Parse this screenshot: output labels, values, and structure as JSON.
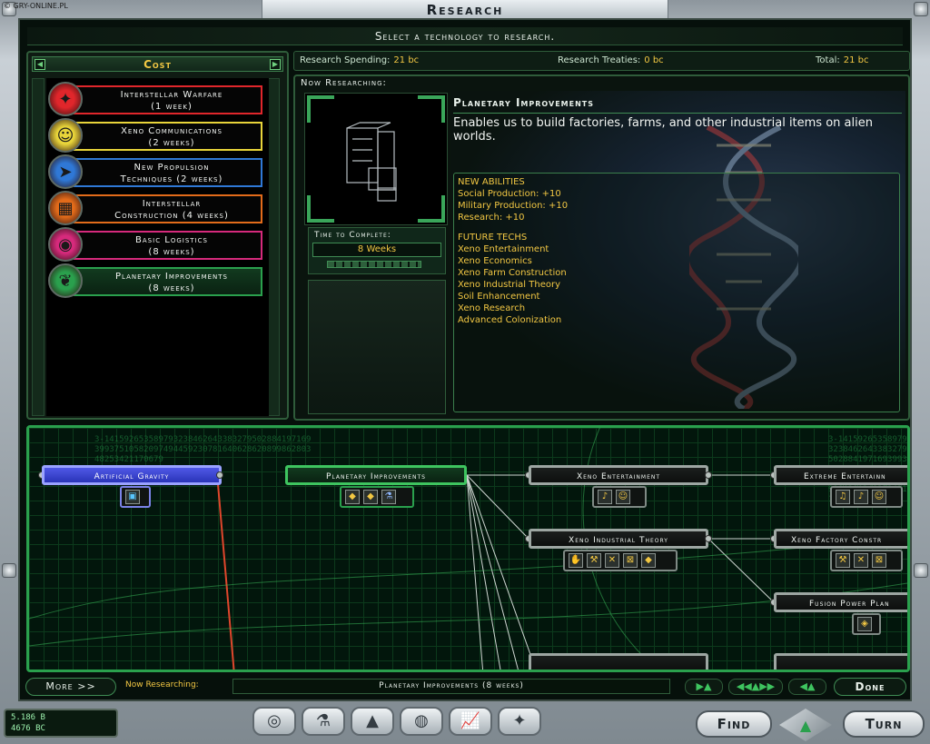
{
  "watermark": "© GRY-ONLINE.PL",
  "window": {
    "title": "Research",
    "subtitle": "Select a technology to research."
  },
  "cost_panel": {
    "title": "Cost",
    "prev_icon": "arrow-left-icon",
    "next_icon": "arrow-right-icon",
    "items": [
      {
        "line1": "Interstellar Warfare",
        "line2": "(1 week)",
        "icon": "warfare-icon",
        "color": "#e0262b"
      },
      {
        "line1": "Xeno Communications",
        "line2": "(2 weeks)",
        "icon": "communications-icon",
        "color": "#e8d43a"
      },
      {
        "line1": "New Propulsion",
        "line2": "Techniques (2 weeks)",
        "icon": "propulsion-icon",
        "color": "#2f78d6"
      },
      {
        "line1": "Interstellar",
        "line2": "Construction (4 weeks)",
        "icon": "construction-icon",
        "color": "#e26b1a"
      },
      {
        "line1": "Basic Logistics",
        "line2": "(8 weeks)",
        "icon": "logistics-icon",
        "color": "#d62a7c"
      },
      {
        "line1": "Planetary Improvements",
        "line2": "(8 weeks)",
        "icon": "planetary-icon",
        "color": "#2aa04d"
      }
    ]
  },
  "info_bar": {
    "spending_label": "Research Spending:",
    "spending_value": "21 bc",
    "treaties_label": "Research Treaties:",
    "treaties_value": "0 bc",
    "total_label": "Total:",
    "total_value": "21 bc"
  },
  "now_researching": {
    "label": "Now Researching:",
    "tech_name": "Planetary Improvements",
    "description": "Enables us to build factories, farms, and other industrial items on alien worlds.",
    "time_label": "Time to Complete:",
    "time_value": "8 Weeks",
    "progress": 1.0,
    "new_abilities_head": "NEW ABILITIES",
    "new_abilities": [
      "Social Production: +10",
      "Military Production: +10",
      "Research: +10"
    ],
    "future_techs_head": "FUTURE TECHS",
    "future_techs": [
      "Xeno Entertainment",
      "Xeno Economics",
      "Xeno Farm Construction",
      "Xeno Industrial Theory",
      "Soil Enhancement",
      "Xeno Research",
      "Advanced Colonization"
    ]
  },
  "tree": {
    "nodes": {
      "artificial_gravity": "Artificial Gravity",
      "planetary_improvements": "Planetary Improvements",
      "xeno_entertainment": "Xeno Entertainment",
      "extreme_entertainment": "Extreme Entertainn",
      "xeno_industrial_theory": "Xeno Industrial Theory",
      "xeno_factory_construction": "Xeno Factory Constr",
      "fusion_power_plant": "Fusion Power Plan"
    },
    "overlay_digits": "3-1415926535897932384626433832795028841971693993751058209749445923078164062862089986280348253421170679"
  },
  "status_bar": {
    "more_label": "More >>",
    "now_label": "Now Researching:",
    "now_value": "Planetary Improvements (8 weeks)",
    "nav1": "▶▲",
    "nav2": "◀◀▲▶▶",
    "nav3": "◀▲",
    "done_label": "Done"
  },
  "resources": {
    "line1": "5.186 B",
    "line2": "4676 BC"
  },
  "dock": [
    {
      "icon": "empire-icon",
      "glyph": "◎"
    },
    {
      "icon": "research-flask-icon",
      "glyph": "⚗"
    },
    {
      "icon": "planets-icon",
      "glyph": "▲"
    },
    {
      "icon": "galaxy-icon",
      "glyph": "◍"
    },
    {
      "icon": "graph-icon",
      "glyph": "📈"
    },
    {
      "icon": "diplomacy-icon",
      "glyph": "✦"
    }
  ],
  "find_label": "Find",
  "turn_label": "Turn"
}
